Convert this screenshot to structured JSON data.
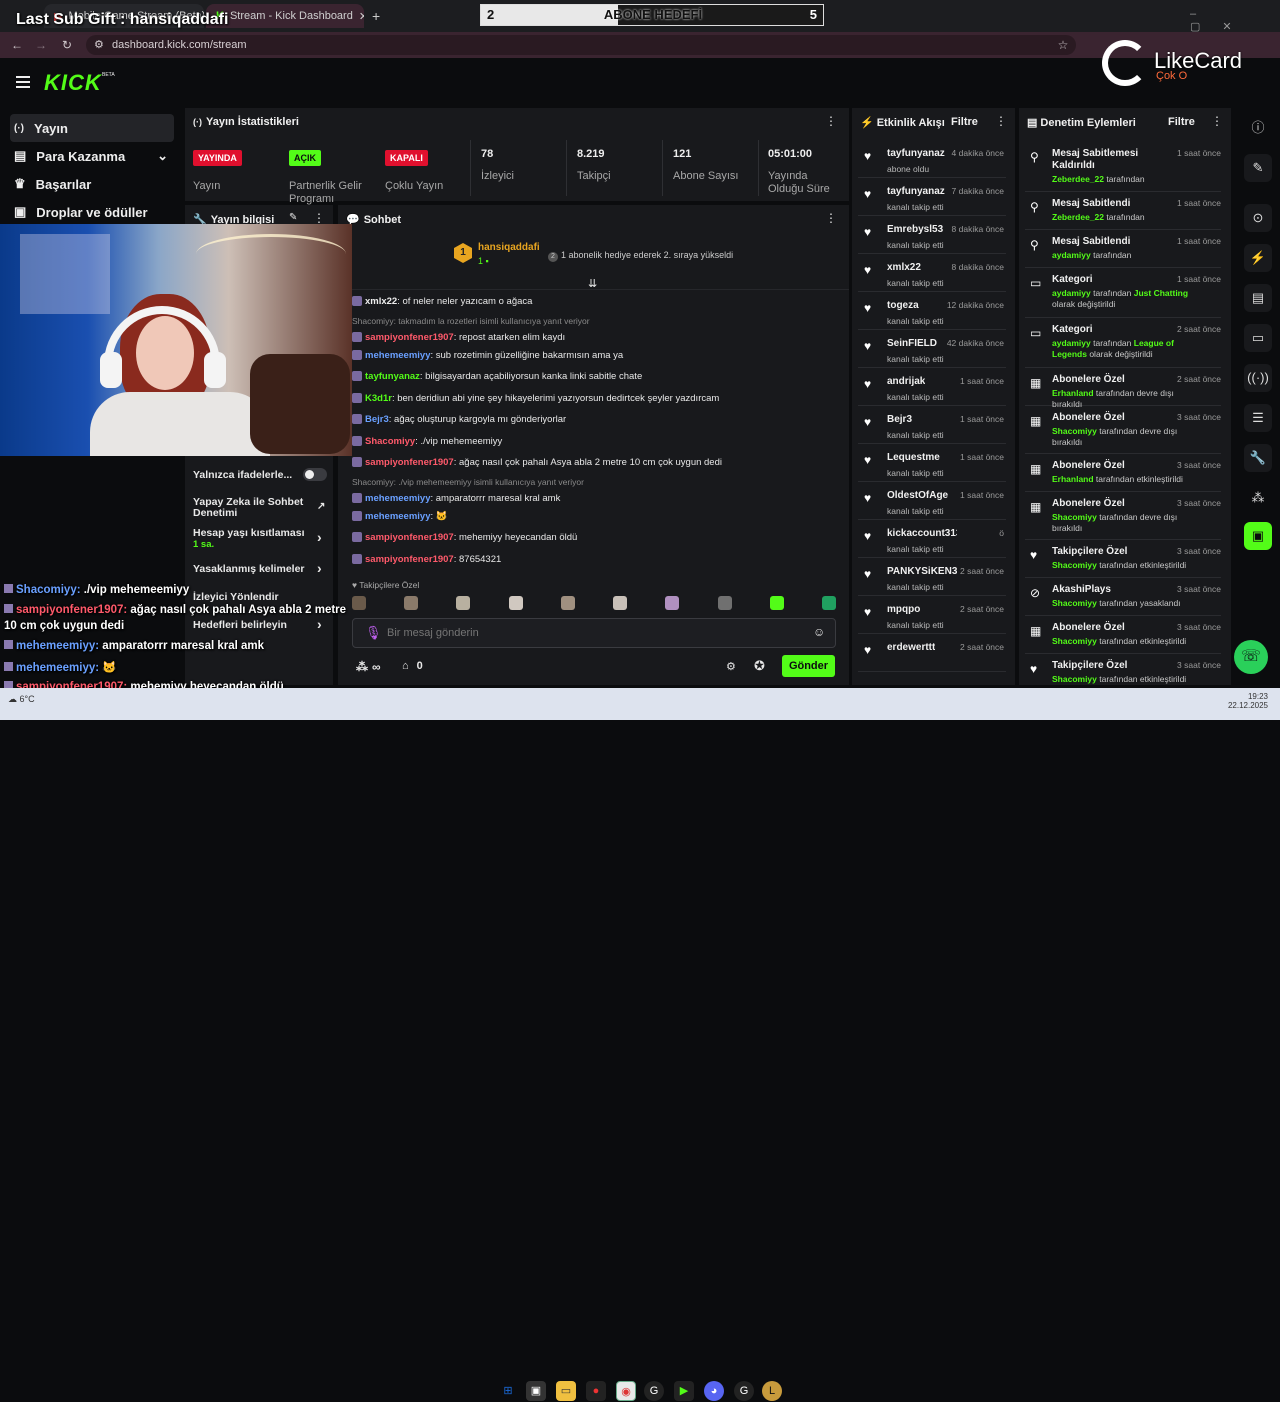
{
  "browser": {
    "tabs": [
      {
        "label": "Mobile Game Stream (Beta)"
      },
      {
        "label": "Stream - Kick Dashboard"
      }
    ],
    "url": "dashboard.kick.com/stream"
  },
  "overlay": {
    "last_sub_gift": "Last Sub Gift : hansiqaddafi",
    "goal": {
      "title": "ABONE HEDEFİ",
      "current": "2",
      "target": "5",
      "progress": 0.4
    },
    "likecard": {
      "brand": "LikeCard",
      "sub": "Çok O"
    },
    "chat": [
      {
        "user": "Shacomiyy:",
        "text": " ./vip mehemeemiyy",
        "color": "#6aa0ff"
      },
      {
        "user": "sampiyonfener1907:",
        "text": " ağaç nasıl çok pahalı Asya abla 2 metre",
        "color": "#ff5a6b"
      },
      {
        "user": "",
        "text": "10 cm çok uygun dedi",
        "color": "#fff"
      },
      {
        "user": "mehemeemiyy:",
        "text": " amparatorrr maresal kral amk",
        "color": "#6aa0ff"
      },
      {
        "user": "mehemeemiyy:",
        "text": " 🐱",
        "color": "#6aa0ff"
      },
      {
        "user": "sampiyonfener1907:",
        "text": " mehemiyy heyecandan öldü",
        "color": "#ff5a6b"
      },
      {
        "user": "sampiyonfener1907:",
        "text": " 87654321",
        "color": "#ff5a6b"
      }
    ]
  },
  "kick": {
    "logo": "KICK",
    "logo_badge": "BETA"
  },
  "sidebar": {
    "items": [
      {
        "label": "Yayın",
        "icon": "broadcast-icon"
      },
      {
        "label": "Para Kazanma",
        "icon": "money-icon"
      },
      {
        "label": "Başarılar",
        "icon": "trophy-icon"
      },
      {
        "label": "Droplar ve ödüller",
        "icon": "gift-icon"
      }
    ]
  },
  "stats": {
    "title": "Yayın İstatistikleri",
    "cells": [
      {
        "badge": "YAYINDA",
        "label": "Yayın",
        "badge_color": "#e0102e"
      },
      {
        "badge": "AÇIK",
        "label": "Partnerlik Gelir Programı",
        "badge_color": "#53fc18"
      },
      {
        "badge": "KAPALI",
        "label": "Çoklu Yayın",
        "badge_color": "#e0102e"
      },
      {
        "value": "78",
        "label": "İzleyici"
      },
      {
        "value": "8.219",
        "label": "Takipçi"
      },
      {
        "value": "121",
        "label": "Abone Sayısı"
      },
      {
        "value": "05:01:00",
        "label": "Yayında Olduğu Süre"
      }
    ]
  },
  "stream_info": {
    "title": "Yayın bilgisi",
    "settings": [
      {
        "label": "Yalnızca ifadelerle..."
      },
      {
        "label": "Yapay Zeka ile Sohbet Denetimi"
      },
      {
        "label": "Hesap yaşı kısıtlaması",
        "value": "1 sa."
      },
      {
        "label": "Yasaklanmış kelimeler"
      },
      {
        "label": "İzleyici Yönlendir"
      },
      {
        "label": "Hedefleri belirleyin"
      }
    ]
  },
  "chat": {
    "title": "Sohbet",
    "pinned": {
      "user": "hansiqaddafi",
      "level": "1",
      "note": "1 abonelik hediye ederek 2. sıraya yükseldi"
    },
    "messages": [
      {
        "user": "xmlx22",
        "text": ": of neler neler yazıcam o ağaca",
        "cls": "u-white",
        "reply": ""
      },
      {
        "user": "sampiyonfener1907",
        "text": ": repost atarken elim kaydı",
        "cls": "u-red",
        "reply": "Shacomiyy: takmadım la rozetleri isimli kullanıcıya yanıt veriyor"
      },
      {
        "user": "mehemeemiyy",
        "text": ": sub rozetimin güzelliğine bakarmısın ama ya",
        "cls": "u-blue",
        "reply": ""
      },
      {
        "user": "tayfunyanaz",
        "text": ": bilgisayardan açabiliyorsun kanka linki sabitle chate",
        "cls": "u-green",
        "reply": ""
      },
      {
        "user": "K3d1r",
        "text": ": ben deridiun abi yine şey hikayelerimi yazıyorsun dedirtcek şeyler yazdırcam",
        "cls": "u-green",
        "reply": ""
      },
      {
        "user": "Bejr3",
        "text": ": ağaç oluşturup kargoyla mı gönderiyorlar",
        "cls": "u-blue",
        "reply": ""
      },
      {
        "user": "Shacomiyy",
        "text": ": ./vip mehemeemiyy",
        "cls": "u-red",
        "reply": ""
      },
      {
        "user": "sampiyonfener1907",
        "text": ": ağaç nasıl çok pahalı Asya abla 2 metre 10 cm çok uygun dedi",
        "cls": "u-red",
        "reply": ""
      },
      {
        "user": "mehemeemiyy",
        "text": ": amparatorrr maresal kral amk",
        "cls": "u-blue",
        "reply": "Shacomiyy: ./vip mehemeemiyy isimli kullanıcıya yanıt veriyor"
      },
      {
        "user": "mehemeemiyy",
        "text": ": 🐱",
        "cls": "u-blue",
        "reply": ""
      },
      {
        "user": "sampiyonfener1907",
        "text": ": mehemiyy heyecandan öldü",
        "cls": "u-red",
        "reply": ""
      },
      {
        "user": "sampiyonfener1907",
        "text": ": 87654321",
        "cls": "u-red",
        "reply": ""
      }
    ],
    "followers_only": "Takipçilere Özel",
    "input_placeholder": "Bir mesaj gönderin",
    "infinity": "∞",
    "count": "0",
    "send_label": "Gönder"
  },
  "activity": {
    "title": "Etkinlik Akışı",
    "filter": "Filtre",
    "items": [
      {
        "name": "tayfunyanaz",
        "time": "4 dakika önce",
        "sub": "abone oldu"
      },
      {
        "name": "tayfunyanaz",
        "time": "7 dakika önce",
        "sub": "kanalı takip etti"
      },
      {
        "name": "Emrebysl53",
        "time": "8 dakika önce",
        "sub": "kanalı takip etti"
      },
      {
        "name": "xmlx22",
        "time": "8 dakika önce",
        "sub": "kanalı takip etti"
      },
      {
        "name": "togeza",
        "time": "12 dakika önce",
        "sub": "kanalı takip etti"
      },
      {
        "name": "SeinFIELD",
        "time": "42 dakika önce",
        "sub": "kanalı takip etti"
      },
      {
        "name": "andrijak",
        "time": "1 saat önce",
        "sub": "kanalı takip etti"
      },
      {
        "name": "Bejr3",
        "time": "1 saat önce",
        "sub": "kanalı takip etti"
      },
      {
        "name": "Lequestme",
        "time": "1 saat önce",
        "sub": "kanalı takip etti"
      },
      {
        "name": "OldestOfAge",
        "time": "1 saat önce",
        "sub": "kanalı takip etti"
      },
      {
        "name": "kickaccount313454567",
        "time": "ö",
        "sub": "kanalı takip etti"
      },
      {
        "name": "PANKYSiKEN3169",
        "time": "2 saat önce",
        "sub": "kanalı takip etti"
      },
      {
        "name": "mpqpo",
        "time": "2 saat önce",
        "sub": "kanalı takip etti"
      },
      {
        "name": "erdewerttt",
        "time": "2 saat önce",
        "sub": ""
      }
    ]
  },
  "moderation": {
    "title": "Denetim Eylemleri",
    "filter": "Filtre",
    "items": [
      {
        "title": "Mesaj Sabitlemesi Kaldırıldı",
        "time": "1 saat önce",
        "actor": "Zeberdee_22",
        "rest": " tarafından",
        "extra": ""
      },
      {
        "title": "Mesaj Sabitlendi",
        "time": "1 saat önce",
        "actor": "Zeberdee_22",
        "rest": " tarafından",
        "extra": ""
      },
      {
        "title": "Mesaj Sabitlendi",
        "time": "1 saat önce",
        "actor": "aydamiyy",
        "rest": " tarafından",
        "extra": ""
      },
      {
        "title": "Kategori",
        "time": "1 saat önce",
        "actor": "aydamiyy",
        "rest": " tarafından ",
        "extra": "Just Chatting",
        "tail": "olarak değiştirildi"
      },
      {
        "title": "Kategori",
        "time": "2 saat önce",
        "actor": "aydamiyy",
        "rest": " tarafından ",
        "extra": "League of Legends",
        "tail": "olarak değiştirildi"
      },
      {
        "title": "Abonelere Özel",
        "time": "2 saat önce",
        "actor": "Erhanland",
        "rest": " tarafından devre dışı bırakıldı",
        "extra": ""
      },
      {
        "title": "Abonelere Özel",
        "time": "3 saat önce",
        "actor": "Shacomiyy",
        "rest": " tarafından devre dışı bırakıldı",
        "extra": ""
      },
      {
        "title": "Abonelere Özel",
        "time": "3 saat önce",
        "actor": "Erhanland",
        "rest": " tarafından etkinleştirildi",
        "extra": ""
      },
      {
        "title": "Abonelere Özel",
        "time": "3 saat önce",
        "actor": "Shacomiyy",
        "rest": " tarafından devre dışı bırakıldı",
        "extra": ""
      },
      {
        "title": "Takipçilere Özel",
        "time": "3 saat önce",
        "actor": "Shacomiyy",
        "rest": " tarafından etkinleştirildi",
        "extra": ""
      },
      {
        "title": "AkashiPlays",
        "time": "3 saat önce",
        "actor": "Shacomiyy",
        "rest": " tarafından yasaklandı",
        "extra": ""
      },
      {
        "title": "Abonelere Özel",
        "time": "3 saat önce",
        "actor": "Shacomiyy",
        "rest": " tarafından etkinleştirildi",
        "extra": ""
      },
      {
        "title": "Takipçilere Özel",
        "time": "3 saat önce",
        "actor": "Shacomiyy",
        "rest": " tarafından etkinleştirildi",
        "extra": ""
      }
    ]
  },
  "taskbar": {
    "weather": "6°C",
    "time": "19:23",
    "date": "22.12.2025"
  },
  "colors": {
    "accent": "#53fc18",
    "bg": "#0b0c0e",
    "panel": "#18191c"
  }
}
